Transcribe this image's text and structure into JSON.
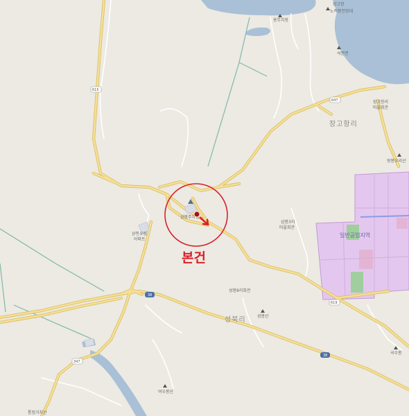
{
  "colors": {
    "background": "#eceae3",
    "water": "#a9c0d6",
    "road_major": "#f3d98a",
    "road_major_edge": "#d9bd62",
    "road_minor": "#ffffff",
    "green_line": "#7fb8a8",
    "zone_fill": "#e4c7ee",
    "zone_edge": "#c498d6",
    "accent_red": "#d8202a"
  },
  "map": {
    "main_label": "본건",
    "areas": {
      "janggo": "장고항리",
      "seongbuk": "성북리",
      "industrial_zone": "일반공업지역"
    },
    "pois": {
      "north_shore_1": "장고항",
      "north_shore_2": "노적봉전망대",
      "north_mid": "용무치항",
      "right_top": "석문면",
      "janggo_office": "장고항리",
      "janggo_office2": "마을회관",
      "peak_right": "왕봉우리산",
      "samyong_office": "삼봉3리",
      "samyong_office2": "마을회관",
      "subject_site": "삼봉주차장",
      "samyong_village": "삼봉우림",
      "samyong_village2": "아파트",
      "seongbuk_office": "성봉8리회관",
      "peak_mid": "성봉산",
      "peak_right_low": "국수봉",
      "peak_bottom": "여우봉산",
      "bottom_left": "통정거치산"
    },
    "route_shields": {
      "r615": "615",
      "r647": "647",
      "r38a": "38",
      "r38b": "38",
      "r619": "619",
      "r347": "347"
    },
    "icons": {
      "target": "map-pin-icon",
      "peak": "mountain-peak-icon",
      "office": "building-icon"
    }
  }
}
